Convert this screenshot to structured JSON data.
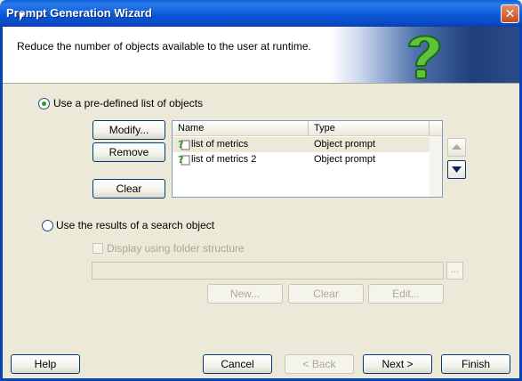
{
  "window": {
    "title": "Prompt Generation Wizard",
    "close_glyph": "✕"
  },
  "header": {
    "description": "Reduce the number of objects available to the user at runtime.",
    "art_icon": "question-mark-icon"
  },
  "option_predefined": {
    "label": "Use a pre-defined list of objects",
    "selected": true
  },
  "buttons_left": {
    "modify": "Modify...",
    "remove": "Remove",
    "clear": "Clear"
  },
  "list": {
    "columns": [
      "Name",
      "Type"
    ],
    "rows": [
      {
        "name": "list of metrics",
        "type": "Object prompt",
        "selected": true,
        "icon": "prompt-icon"
      },
      {
        "name": "list of metrics 2",
        "type": "Object prompt",
        "selected": false,
        "icon": "prompt-icon"
      }
    ]
  },
  "order_buttons": {
    "up_icon": "arrow-up-icon",
    "down_icon": "arrow-down-icon"
  },
  "option_search": {
    "label": "Use the results of a search object",
    "selected": false
  },
  "search_panel": {
    "folder_checkbox_label": "Display using folder structure",
    "search_value": "",
    "browse_label": "...",
    "new": "New...",
    "clear": "Clear",
    "edit": "Edit..."
  },
  "footer": {
    "help": "Help",
    "cancel": "Cancel",
    "back": "< Back",
    "next": "Next >",
    "finish": "Finish"
  }
}
